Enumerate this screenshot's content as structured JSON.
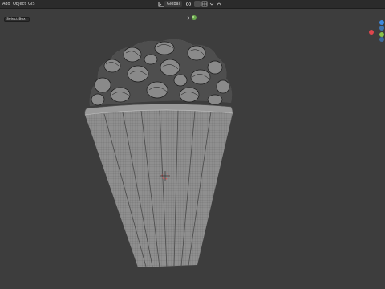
{
  "menu": {
    "items": [
      "Add",
      "Object",
      "GIS"
    ]
  },
  "header": {
    "transform_label": "Global",
    "select_mode": "Select Box"
  },
  "gizmo": {
    "colors": {
      "x": "#e0464d",
      "y": "#8bc34a",
      "z": "#3d8be0"
    }
  },
  "theme": {
    "header_bg": "#2b2b2b",
    "viewport_bg": "#3d3d3d"
  }
}
